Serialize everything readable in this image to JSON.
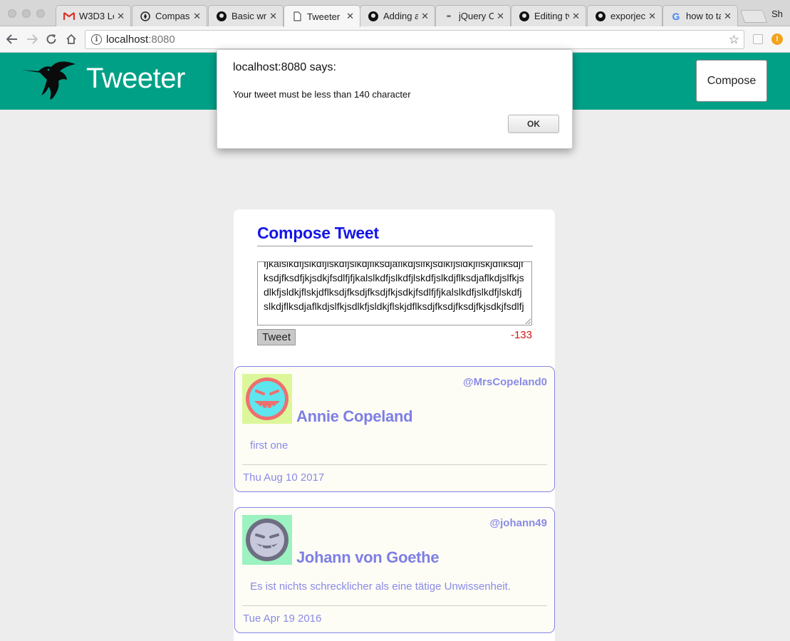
{
  "browser": {
    "tabs": [
      {
        "title": "W3D3 Le",
        "icon": "gmail-icon",
        "active": false
      },
      {
        "title": "Compass",
        "icon": "compass-icon",
        "active": false
      },
      {
        "title": "Basic writ",
        "icon": "github-icon",
        "active": false
      },
      {
        "title": "Tweeter",
        "icon": "document-icon",
        "active": true
      },
      {
        "title": "Adding ar",
        "icon": "github-icon",
        "active": false
      },
      {
        "title": "jQuery Cl",
        "icon": "jquery-icon",
        "active": false
      },
      {
        "title": "Editing tv",
        "icon": "github-icon",
        "active": false
      },
      {
        "title": "exporject",
        "icon": "github-icon",
        "active": false
      },
      {
        "title": "how to ta",
        "icon": "google-icon",
        "active": false
      }
    ],
    "profile_label": "Sh",
    "url_host": "localhost",
    "url_port": ":8080",
    "alert_badge": "!"
  },
  "header": {
    "title": "Tweeter",
    "compose_label": "Compose"
  },
  "compose": {
    "heading": "Compose Tweet",
    "text": "fjkalslkdfjslkdfjlskdfjslkdjflksdjaflkdjslfkjsdlkfjsldkjflskjdflksdjfksdjfksdfjkjsdkjfsdlfjfjkalslkdfjslkdfjlskdfjslkdjflksdjaflkdjslfkjsdlkfjsldkjflskjdflksdjfksdjfksdjfkjsdkjfsdlfjfjkalslkdfjslkdfjlskdfjslkdjflksdjaflkdjslfkjsdlkfjsldkjflskjdflksdjfksdjfksdjfkjsdkjfsdlfj",
    "button_label": "Tweet",
    "counter": "-133"
  },
  "tweets": [
    {
      "name": "Annie Copeland",
      "handle": "@MrsCopeland0",
      "body": "first one",
      "date": "Thu Aug 10 2017",
      "avatar_bg": "#dcf79a",
      "avatar_face": "#ee6f6f",
      "avatar_accent": "#5ee6ee"
    },
    {
      "name": "Johann von Goethe",
      "handle": "@johann49",
      "body": "Es ist nichts schrecklicher als eine tätige Unwissenheit.",
      "date": "Tue Apr 19 2016",
      "avatar_bg": "#9cf2c0",
      "avatar_face": "#6e6e82",
      "avatar_accent": "#c8c8dc"
    }
  ],
  "dialog": {
    "title": "localhost:8080 says:",
    "message": "Your tweet must be less than 140 character",
    "ok_label": "OK"
  },
  "colors": {
    "header_bg": "#00a087",
    "heading_blue": "#1515e6",
    "tweet_text": "#8a8ae8",
    "counter_red": "#e01010"
  }
}
